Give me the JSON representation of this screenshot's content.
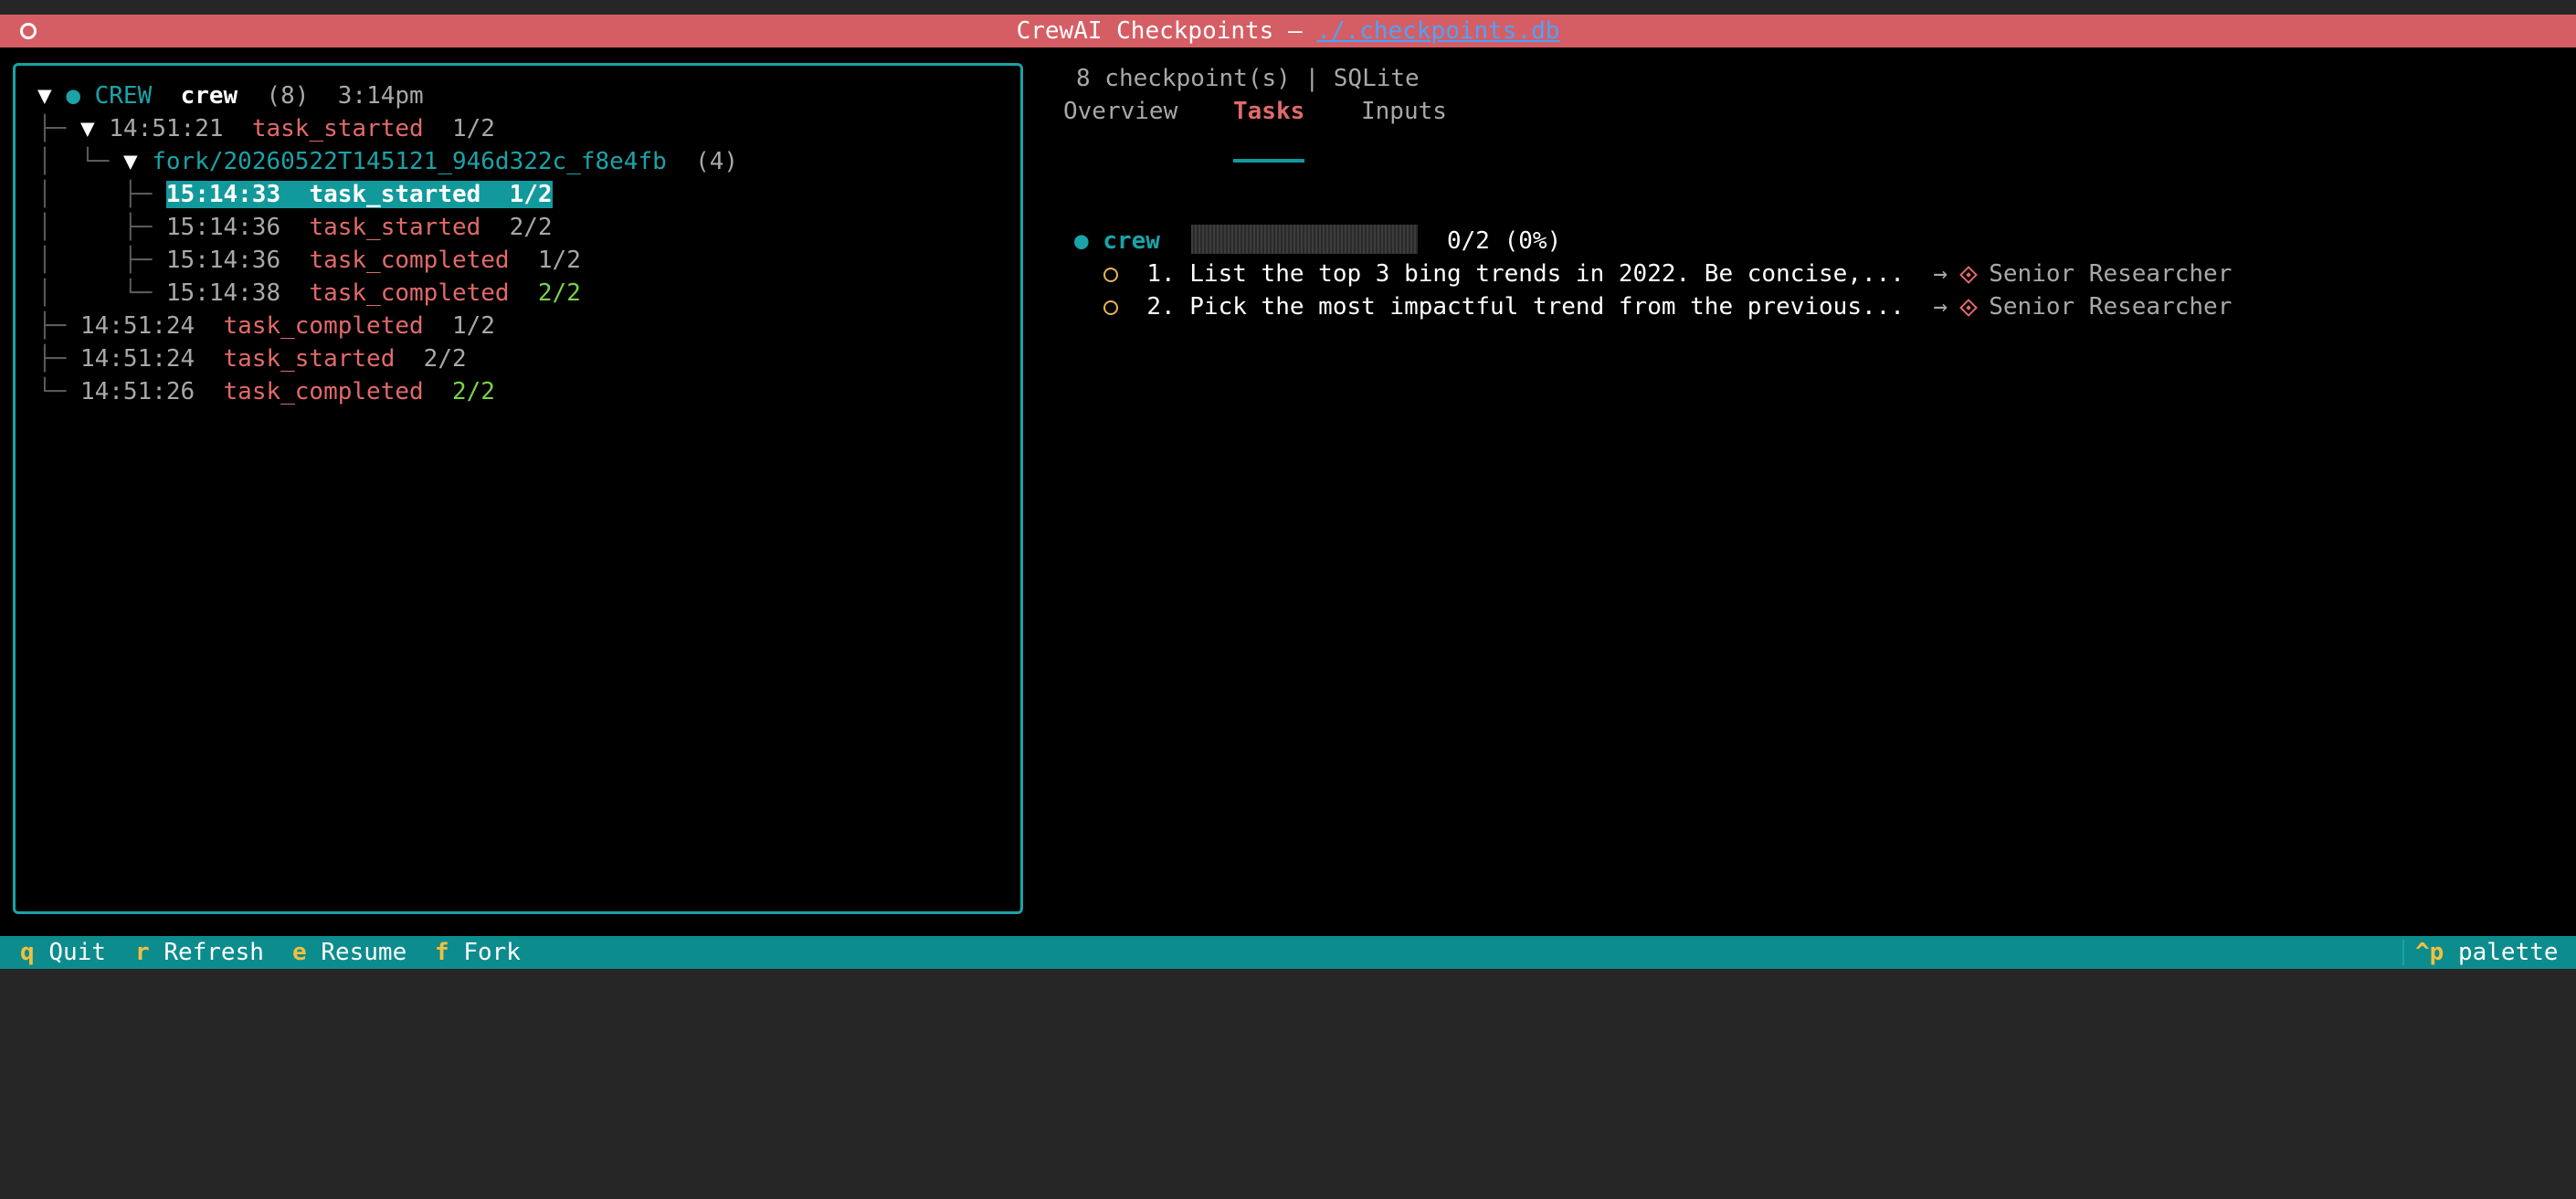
{
  "titlebar": {
    "app_title": "CrewAI Checkpoints — ",
    "db_path": "./.checkpoints.db"
  },
  "tree": {
    "root": {
      "type_label": "CREW",
      "name": "crew",
      "count": "(8)",
      "time": "3:14pm"
    },
    "nodes": [
      {
        "time": "14:51:21",
        "event": "task_started",
        "progress": "1/2"
      },
      {
        "fork_name": "fork/20260522T145121_946d322c_f8e4fb",
        "fork_count": "(4)"
      },
      {
        "time": "15:14:33",
        "event": "task_started",
        "progress": "1/2"
      },
      {
        "time": "15:14:36",
        "event": "task_started",
        "progress": "2/2"
      },
      {
        "time": "15:14:36",
        "event": "task_completed",
        "progress": "1/2"
      },
      {
        "time": "15:14:38",
        "event": "task_completed",
        "progress": "2/2"
      },
      {
        "time": "14:51:24",
        "event": "task_completed",
        "progress": "1/2"
      },
      {
        "time": "14:51:24",
        "event": "task_started",
        "progress": "2/2"
      },
      {
        "time": "14:51:26",
        "event": "task_completed",
        "progress": "2/2"
      }
    ]
  },
  "detail": {
    "meta": "8 checkpoint(s) | SQLite",
    "tabs": [
      "Overview",
      "Tasks",
      "Inputs"
    ],
    "active_tab": "Tasks",
    "crew": {
      "name": "crew",
      "progress_label": "0/2 (0%)",
      "progress_fraction": 0
    },
    "tasks": [
      {
        "index": "1.",
        "text": "List the top 3 bing trends in 2022. Be concise,...",
        "agent": "Senior Researcher"
      },
      {
        "index": "2.",
        "text": "Pick the most impactful trend from the previous...",
        "agent": "Senior Researcher"
      }
    ]
  },
  "statusbar": {
    "quit_key": "q",
    "quit_label": "Quit",
    "refresh_key": "r",
    "refresh_label": "Refresh",
    "resume_key": "e",
    "resume_label": "Resume",
    "fork_key": "f",
    "fork_label": "Fork",
    "palette_key": "^p",
    "palette_label": "palette"
  },
  "colors": {
    "titlebar": "#d55e64",
    "accent": "#12999c",
    "event_red": "#e26a6a",
    "done_green": "#7ad24d",
    "key_yellow": "#f0c040"
  }
}
